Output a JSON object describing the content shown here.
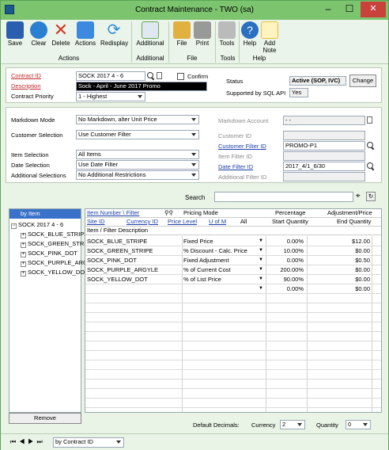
{
  "window": {
    "title": "Contract Maintenance  -  TWO (sa)",
    "min": "–",
    "max": "☐",
    "close": "✕"
  },
  "toolbar": {
    "buttons": [
      {
        "label": "Save",
        "icon": "save-icon",
        "color": "#2a5fb0"
      },
      {
        "label": "Clear",
        "icon": "clear-icon",
        "color": "#2a7fd0"
      },
      {
        "label": "Delete",
        "icon": "delete-icon",
        "color": "#d23a2a"
      },
      {
        "label": "Actions",
        "icon": "actions-icon",
        "color": "#3c8adf"
      },
      {
        "label": "Redisplay",
        "icon": "redisplay-icon",
        "color": "#2f8fd8"
      },
      {
        "label": "Additional",
        "icon": "additional-icon",
        "color": "#6aa84f"
      },
      {
        "label": "File",
        "icon": "file-icon",
        "color": "#e0b040"
      },
      {
        "label": "Print",
        "icon": "print-icon",
        "color": "#777777"
      },
      {
        "label": "Tools",
        "icon": "tools-icon",
        "color": "#888888"
      },
      {
        "label": "Help",
        "icon": "help-icon",
        "color": "#2a6fc0"
      },
      {
        "label": "Add Note",
        "icon": "add-note-icon",
        "color": "#e8c040"
      }
    ],
    "groups": [
      "Actions",
      "Additional",
      "File",
      "Tools",
      "Help"
    ]
  },
  "header": {
    "contract_id_label": "Contract ID",
    "contract_id": "SOCK 2017 4 - 6",
    "confirm_label": "Confirm",
    "description_label": "Description",
    "description": "Sock - April - June 2017 Promo",
    "priority_label": "Contract Priority",
    "priority": "1 - Highest",
    "status_label": "Status",
    "status": "Active (SOP, IVC)",
    "change_label": "Change",
    "sql_label": "Supported by SQL API",
    "sql_value": "Yes"
  },
  "selection": {
    "markdown_mode_label": "Markdown Mode",
    "markdown_mode": "No Markdown, alter Unit Price",
    "customer_selection_label": "Customer Selection",
    "customer_selection": "Use Customer Filter",
    "item_selection_label": "Item Selection",
    "item_selection": "All Items",
    "date_selection_label": "Date Selection",
    "date_selection": "Use Date Filter",
    "additional_selections_label": "Additional Selections",
    "additional_selections": "No Additional Restrictions",
    "markdown_account_label": "Markdown Account",
    "markdown_account": "-     -",
    "customer_id_label": "Customer ID",
    "customer_filter_label": "Customer Filter ID",
    "customer_filter": "PROMO-P1",
    "item_filter_label": "Item Filter ID",
    "date_filter_label": "Date Filter ID",
    "date_filter": "2017_4/1_6/30",
    "additional_filter_label": "Additional Filter ID"
  },
  "search": {
    "label": "Search"
  },
  "tree": {
    "header": "by Item",
    "root": "SOCK 2017 4 - 6",
    "items": [
      "SOCK_BLUE_STRIPE",
      "SOCK_GREEN_STRIPE",
      "SOCK_PINK_DOT",
      "SOCK_PURPLE_ARGYLE",
      "SOCK_YELLOW_DOT"
    ],
    "remove_label": "Remove"
  },
  "grid": {
    "h1": {
      "item": "Item Number \\ Filter",
      "pricing": "Pricing Mode",
      "percentage": "Percentage",
      "adjustment": "Adjustment/Price"
    },
    "h2": {
      "site": "Site ID",
      "currency": "Currency ID",
      "price_level": "Price Level",
      "uofm": "U of M",
      "all": "All",
      "start_qty": "Start Quantity",
      "end_qty": "End Quantity"
    },
    "h3": {
      "desc": "Item / Filter Description"
    },
    "rows": [
      {
        "item": "SOCK_BLUE_STRIPE",
        "mode": "Fixed Price",
        "pct": "0.00%",
        "adj": "$12.00"
      },
      {
        "item": "SOCK_GREEN_STRIPE",
        "mode": "% Discount - Calc. Price",
        "pct": "10.00%",
        "adj": "$0.00"
      },
      {
        "item": "SOCK_PINK_DOT",
        "mode": "Fixed Adjustment",
        "pct": "0.00%",
        "adj": "$0.50"
      },
      {
        "item": "SOCK_PURPLE_ARGYLE",
        "mode": "% of Current Cost",
        "pct": "200.00%",
        "adj": "$0.00"
      },
      {
        "item": "SOCK_YELLOW_DOT",
        "mode": "% of List Price",
        "pct": "90.00%",
        "adj": "$0.00"
      },
      {
        "item": "",
        "mode": "",
        "pct": "0.00%",
        "adj": "$0.00"
      }
    ]
  },
  "footer": {
    "default_decimals_label": "Default Decimals:",
    "currency_label": "Currency",
    "currency_value": "2",
    "quantity_label": "Quantity",
    "quantity_value": "0",
    "sort_value": "by Contract ID"
  }
}
